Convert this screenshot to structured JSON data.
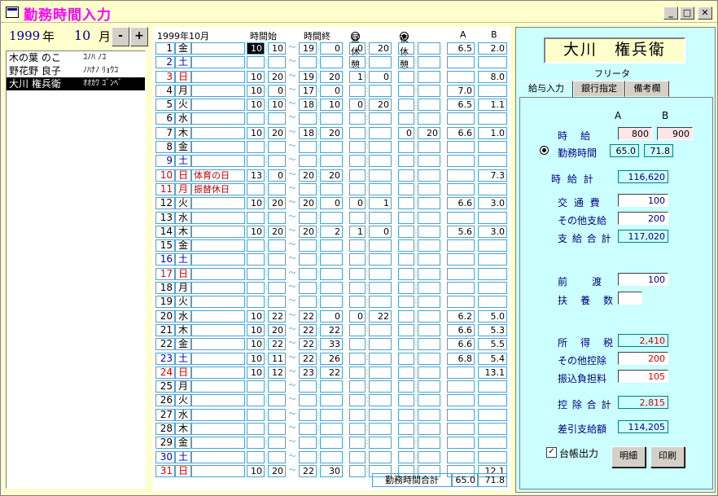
{
  "window": {
    "title": "勤務時間入力"
  },
  "period": {
    "year": "1999",
    "year_unit": "年",
    "month": "10",
    "month_unit": "月",
    "minus": "-",
    "plus": "+"
  },
  "employees": [
    {
      "name": "木の葉 のこ",
      "kana": "ｺﾉﾊ ﾉｺ"
    },
    {
      "name": "野花野 良子",
      "kana": "ﾉﾊﾅﾉ ﾘｮｳｺ"
    },
    {
      "name": "大川 権兵衛",
      "kana": "ｵｵｶﾜ ｺﾞﾝﾍﾞ",
      "selected": true
    }
  ],
  "grid": {
    "month_label": "1999年10月",
    "hdr_start": "時間始",
    "hdr_end": "時間終",
    "hdr_day_break": "昼休憩",
    "hdr_night_break": "夜休憩",
    "hdr_a": "A",
    "hdr_b": "B",
    "total_label": "勤務時間合計",
    "total_a": "65.0",
    "total_b": "71.8",
    "rows": [
      {
        "d": "1",
        "w": "金",
        "h": "",
        "sh": "10",
        "sm": "10",
        "eh": "19",
        "em": "0",
        "bh": "0",
        "bm": "20",
        "nh": "",
        "nm": "",
        "a": "6.5",
        "b": "2.0",
        "c": ""
      },
      {
        "d": "2",
        "w": "土",
        "h": "",
        "sh": "",
        "sm": "",
        "eh": "",
        "em": "",
        "bh": "",
        "bm": "",
        "nh": "",
        "nm": "",
        "a": "",
        "b": "",
        "c": "blue"
      },
      {
        "d": "3",
        "w": "日",
        "h": "",
        "sh": "10",
        "sm": "20",
        "eh": "19",
        "em": "20",
        "bh": "1",
        "bm": "0",
        "nh": "",
        "nm": "",
        "a": "",
        "b": "8.0",
        "c": "red"
      },
      {
        "d": "4",
        "w": "月",
        "h": "",
        "sh": "10",
        "sm": "0",
        "eh": "17",
        "em": "0",
        "bh": "",
        "bm": "",
        "nh": "",
        "nm": "",
        "a": "7.0",
        "b": "",
        "c": ""
      },
      {
        "d": "5",
        "w": "火",
        "h": "",
        "sh": "10",
        "sm": "10",
        "eh": "18",
        "em": "10",
        "bh": "0",
        "bm": "20",
        "nh": "",
        "nm": "",
        "a": "6.5",
        "b": "1.1",
        "c": ""
      },
      {
        "d": "6",
        "w": "水",
        "h": "",
        "sh": "",
        "sm": "",
        "eh": "",
        "em": "",
        "bh": "",
        "bm": "",
        "nh": "",
        "nm": "",
        "a": "",
        "b": "",
        "c": ""
      },
      {
        "d": "7",
        "w": "木",
        "h": "",
        "sh": "10",
        "sm": "20",
        "eh": "18",
        "em": "20",
        "bh": "",
        "bm": "",
        "nh": "0",
        "nm": "20",
        "a": "6.6",
        "b": "1.0",
        "c": ""
      },
      {
        "d": "8",
        "w": "金",
        "h": "",
        "sh": "",
        "sm": "",
        "eh": "",
        "em": "",
        "bh": "",
        "bm": "",
        "nh": "",
        "nm": "",
        "a": "",
        "b": "",
        "c": ""
      },
      {
        "d": "9",
        "w": "土",
        "h": "",
        "sh": "",
        "sm": "",
        "eh": "",
        "em": "",
        "bh": "",
        "bm": "",
        "nh": "",
        "nm": "",
        "a": "",
        "b": "",
        "c": "blue"
      },
      {
        "d": "10",
        "w": "日",
        "h": "体育の日",
        "sh": "13",
        "sm": "0",
        "eh": "20",
        "em": "20",
        "bh": "",
        "bm": "",
        "nh": "",
        "nm": "",
        "a": "",
        "b": "7.3",
        "c": "red"
      },
      {
        "d": "11",
        "w": "月",
        "h": "振替休日",
        "sh": "",
        "sm": "",
        "eh": "",
        "em": "",
        "bh": "",
        "bm": "",
        "nh": "",
        "nm": "",
        "a": "",
        "b": "",
        "c": "red"
      },
      {
        "d": "12",
        "w": "火",
        "h": "",
        "sh": "10",
        "sm": "20",
        "eh": "20",
        "em": "0",
        "bh": "0",
        "bm": "1",
        "nh": "",
        "nm": "",
        "a": "6.6",
        "b": "3.0",
        "c": ""
      },
      {
        "d": "13",
        "w": "水",
        "h": "",
        "sh": "",
        "sm": "",
        "eh": "",
        "em": "",
        "bh": "",
        "bm": "",
        "nh": "",
        "nm": "",
        "a": "",
        "b": "",
        "c": ""
      },
      {
        "d": "14",
        "w": "木",
        "h": "",
        "sh": "10",
        "sm": "20",
        "eh": "20",
        "em": "2",
        "bh": "1",
        "bm": "0",
        "nh": "",
        "nm": "",
        "a": "5.6",
        "b": "3.0",
        "c": ""
      },
      {
        "d": "15",
        "w": "金",
        "h": "",
        "sh": "",
        "sm": "",
        "eh": "",
        "em": "",
        "bh": "",
        "bm": "",
        "nh": "",
        "nm": "",
        "a": "",
        "b": "",
        "c": ""
      },
      {
        "d": "16",
        "w": "土",
        "h": "",
        "sh": "",
        "sm": "",
        "eh": "",
        "em": "",
        "bh": "",
        "bm": "",
        "nh": "",
        "nm": "",
        "a": "",
        "b": "",
        "c": "blue"
      },
      {
        "d": "17",
        "w": "日",
        "h": "",
        "sh": "",
        "sm": "",
        "eh": "",
        "em": "",
        "bh": "",
        "bm": "",
        "nh": "",
        "nm": "",
        "a": "",
        "b": "",
        "c": "red"
      },
      {
        "d": "18",
        "w": "月",
        "h": "",
        "sh": "",
        "sm": "",
        "eh": "",
        "em": "",
        "bh": "",
        "bm": "",
        "nh": "",
        "nm": "",
        "a": "",
        "b": "",
        "c": ""
      },
      {
        "d": "19",
        "w": "火",
        "h": "",
        "sh": "",
        "sm": "",
        "eh": "",
        "em": "",
        "bh": "",
        "bm": "",
        "nh": "",
        "nm": "",
        "a": "",
        "b": "",
        "c": ""
      },
      {
        "d": "20",
        "w": "水",
        "h": "",
        "sh": "10",
        "sm": "22",
        "eh": "22",
        "em": "0",
        "bh": "0",
        "bm": "22",
        "nh": "",
        "nm": "",
        "a": "6.2",
        "b": "5.0",
        "c": ""
      },
      {
        "d": "21",
        "w": "木",
        "h": "",
        "sh": "10",
        "sm": "20",
        "eh": "22",
        "em": "22",
        "bh": "",
        "bm": "",
        "nh": "",
        "nm": "",
        "a": "6.6",
        "b": "5.3",
        "c": ""
      },
      {
        "d": "22",
        "w": "金",
        "h": "",
        "sh": "10",
        "sm": "22",
        "eh": "22",
        "em": "33",
        "bh": "",
        "bm": "",
        "nh": "",
        "nm": "",
        "a": "6.6",
        "b": "5.5",
        "c": ""
      },
      {
        "d": "23",
        "w": "土",
        "h": "",
        "sh": "10",
        "sm": "11",
        "eh": "22",
        "em": "26",
        "bh": "",
        "bm": "",
        "nh": "",
        "nm": "",
        "a": "6.8",
        "b": "5.4",
        "c": "blue"
      },
      {
        "d": "24",
        "w": "日",
        "h": "",
        "sh": "10",
        "sm": "12",
        "eh": "23",
        "em": "22",
        "bh": "",
        "bm": "",
        "nh": "",
        "nm": "",
        "a": "",
        "b": "13.1",
        "c": "red"
      },
      {
        "d": "25",
        "w": "月",
        "h": "",
        "sh": "",
        "sm": "",
        "eh": "",
        "em": "",
        "bh": "",
        "bm": "",
        "nh": "",
        "nm": "",
        "a": "",
        "b": "",
        "c": ""
      },
      {
        "d": "26",
        "w": "火",
        "h": "",
        "sh": "",
        "sm": "",
        "eh": "",
        "em": "",
        "bh": "",
        "bm": "",
        "nh": "",
        "nm": "",
        "a": "",
        "b": "",
        "c": ""
      },
      {
        "d": "27",
        "w": "水",
        "h": "",
        "sh": "",
        "sm": "",
        "eh": "",
        "em": "",
        "bh": "",
        "bm": "",
        "nh": "",
        "nm": "",
        "a": "",
        "b": "",
        "c": ""
      },
      {
        "d": "28",
        "w": "木",
        "h": "",
        "sh": "",
        "sm": "",
        "eh": "",
        "em": "",
        "bh": "",
        "bm": "",
        "nh": "",
        "nm": "",
        "a": "",
        "b": "",
        "c": ""
      },
      {
        "d": "29",
        "w": "金",
        "h": "",
        "sh": "",
        "sm": "",
        "eh": "",
        "em": "",
        "bh": "",
        "bm": "",
        "nh": "",
        "nm": "",
        "a": "",
        "b": "",
        "c": ""
      },
      {
        "d": "30",
        "w": "土",
        "h": "",
        "sh": "",
        "sm": "",
        "eh": "",
        "em": "",
        "bh": "",
        "bm": "",
        "nh": "",
        "nm": "",
        "a": "",
        "b": "",
        "c": "blue"
      },
      {
        "d": "31",
        "w": "日",
        "h": "",
        "sh": "10",
        "sm": "20",
        "eh": "22",
        "em": "30",
        "bh": "",
        "bm": "",
        "nh": "",
        "nm": "",
        "a": "",
        "b": "12.1",
        "c": "red"
      }
    ]
  },
  "employee_panel": {
    "name": "大川　権兵衛",
    "furigana_label": "フリータ",
    "tabs": [
      "給与入力",
      "銀行指定",
      "備考欄"
    ],
    "col_a": "A",
    "col_b": "B",
    "wage_label": "時　給",
    "wage_a": "800",
    "wage_b": "900",
    "hours_label": "勤務時間",
    "hours_a": "65.0",
    "hours_b": "71.8",
    "wage_total_label": "時 給 計",
    "wage_total": "116,620",
    "transport_label": "交 通 費",
    "transport": "100",
    "other_pay_label": "その他支給",
    "other_pay": "200",
    "pay_total_label": "支 給 合 計",
    "pay_total": "117,020",
    "advance_label": "前　　渡",
    "advance": "100",
    "dependents_label": "扶　養　数",
    "dependents": "",
    "income_tax_label": "所　得　税",
    "income_tax": "2,410",
    "other_deduct_label": "その他控除",
    "other_deduct": "200",
    "transfer_fee_label": "振込負担料",
    "transfer_fee": "105",
    "deduct_total_label": "控 除 合 計",
    "deduct_total": "2,815",
    "net_pay_label": "差引支給額",
    "net_pay": "114,205",
    "ledger_label": "台帳出力",
    "detail_button": "明細",
    "print_button": "印刷"
  }
}
